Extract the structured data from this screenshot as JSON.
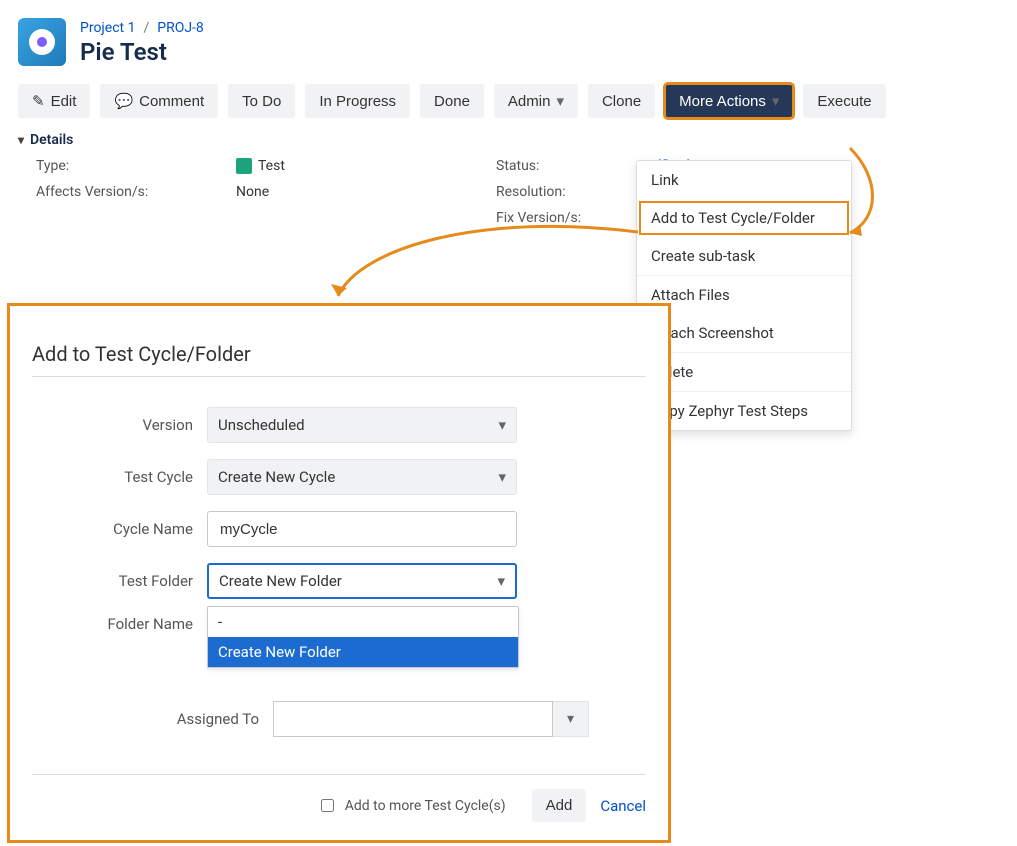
{
  "breadcrumb": {
    "project": "Project 1",
    "issue": "PROJ-8"
  },
  "page_title": "Pie Test",
  "toolbar": {
    "edit": "Edit",
    "comment": "Comment",
    "todo": "To Do",
    "inprogress": "In Progress",
    "done": "Done",
    "admin": "Admin",
    "clone": "Clone",
    "more": "More Actions",
    "execute": "Execute"
  },
  "details": {
    "header": "Details",
    "type_label": "Type:",
    "type_value": "Test",
    "affects_label": "Affects Version/s:",
    "affects_value": "None",
    "status_label": "Status:",
    "resolution_label": "Resolution:",
    "fix_label": "Fix Version/s:",
    "workflow_link": "(flow)"
  },
  "menu": {
    "link": "Link",
    "add_to_cycle": "Add to Test Cycle/Folder",
    "create_subtask": "Create sub-task",
    "attach_files": "Attach Files",
    "attach_screenshot": "Attach Screenshot",
    "delete": "Delete",
    "copy_steps": "Copy Zephyr Test Steps"
  },
  "modal": {
    "title": "Add to Test Cycle/Folder",
    "version_label": "Version",
    "version_value": "Unscheduled",
    "cycle_label": "Test Cycle",
    "cycle_value": "Create New Cycle",
    "cycle_name_label": "Cycle Name",
    "cycle_name_value": "myCycle",
    "folder_label": "Test Folder",
    "folder_value": "Create New Folder",
    "folder_options": {
      "opt1": "-",
      "opt2": "Create New Folder"
    },
    "folder_name_label": "Folder Name",
    "assigned_label": "Assigned To",
    "footer": {
      "checkbox_label": "Add to more Test Cycle(s)",
      "add": "Add",
      "cancel": "Cancel"
    }
  }
}
